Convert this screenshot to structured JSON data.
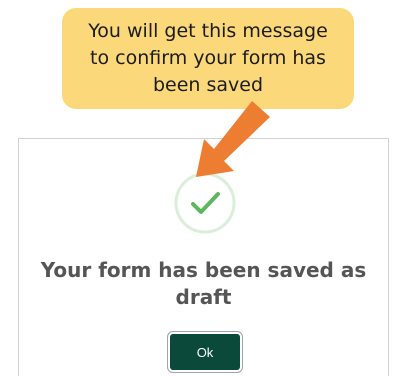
{
  "callout": {
    "text": "You will get this message to confirm your form has been saved"
  },
  "dialog": {
    "message": "Your form has been saved as draft",
    "ok_label": "Ok",
    "icon": "check-circle-icon"
  },
  "colors": {
    "callout_bg": "#fbd87a",
    "arrow": "#ed7d31",
    "check": "#5cb85c",
    "ok_button_bg": "#0b4a3b",
    "message_text": "#555555"
  }
}
